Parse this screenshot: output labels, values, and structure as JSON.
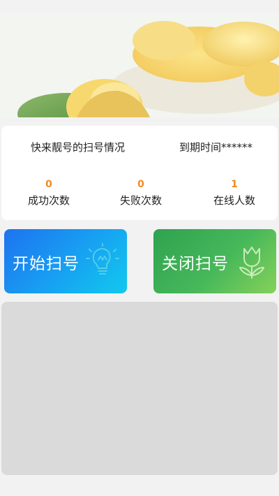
{
  "banner": {
    "slide_count": 2,
    "active_slide": 1,
    "image": "durian-photo"
  },
  "info": {
    "title": "快来靓号的扫号情况",
    "expire": "到期时间******"
  },
  "stats": [
    {
      "value": "0",
      "label": "成功次数"
    },
    {
      "value": "0",
      "label": "失败次数"
    },
    {
      "value": "1",
      "label": "在线人数"
    }
  ],
  "actions": {
    "start": {
      "label": "开始扫号",
      "icon": "lightbulb-icon"
    },
    "stop": {
      "label": "关闭扫号",
      "icon": "tulip-icon"
    }
  },
  "colors": {
    "stat_value": "#f08a24",
    "start_button": "#1e73ef",
    "stop_button": "#47b85a",
    "log_panel": "#dadada"
  }
}
